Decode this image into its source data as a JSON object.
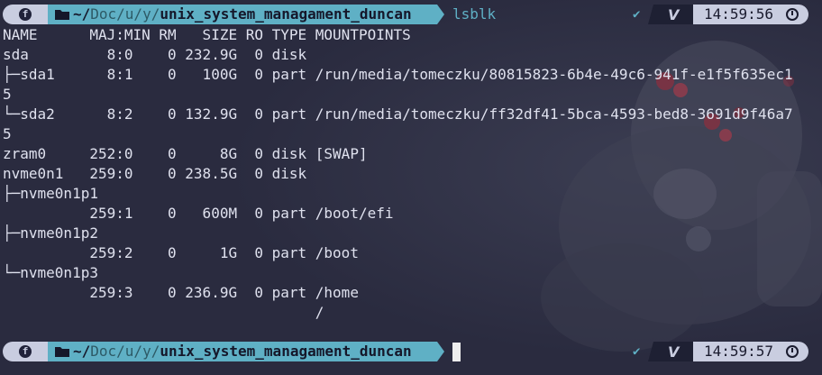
{
  "colors": {
    "background": "#2a2b3f",
    "prompt_light": "#c9cde0",
    "prompt_accent": "#5fb0c5",
    "prompt_vim": "#1e2033",
    "text": "#dfe1ee"
  },
  "prompt1": {
    "os_icon": "fedora-icon",
    "path_prefix": "~/",
    "path_dim": "Doc/u/y/",
    "path_current": "unix_system_managament_duncan",
    "command": "lsblk",
    "status_icon": "check-icon",
    "mode_icon": "vim-icon",
    "time": "14:59:56",
    "time_icon": "clock-icon"
  },
  "output_lines": [
    "NAME      MAJ:MIN RM   SIZE RO TYPE MOUNTPOINTS",
    "sda         8:0    0 232.9G  0 disk ",
    "├─sda1      8:1    0   100G  0 part /run/media/tomeczku/80815823-6b4e-49c6-941f-e1f5f635ec1",
    "5",
    "└─sda2      8:2    0 132.9G  0 part /run/media/tomeczku/ff32df41-5bca-4593-bed8-3691d9f46a7",
    "5",
    "zram0     252:0    0     8G  0 disk [SWAP]",
    "nvme0n1   259:0    0 238.5G  0 disk ",
    "├─nvme0n1p1",
    "          259:1    0   600M  0 part /boot/efi",
    "├─nvme0n1p2",
    "          259:2    0     1G  0 part /boot",
    "└─nvme0n1p3",
    "          259:3    0 236.9G  0 part /home",
    "                                    /"
  ],
  "prompt2": {
    "os_icon": "fedora-icon",
    "path_prefix": "~/",
    "path_dim": "Doc/u/y/",
    "path_current": "unix_system_managament_duncan",
    "command": "",
    "status_icon": "check-icon",
    "mode_icon": "vim-icon",
    "time": "14:59:57",
    "time_icon": "clock-icon"
  }
}
